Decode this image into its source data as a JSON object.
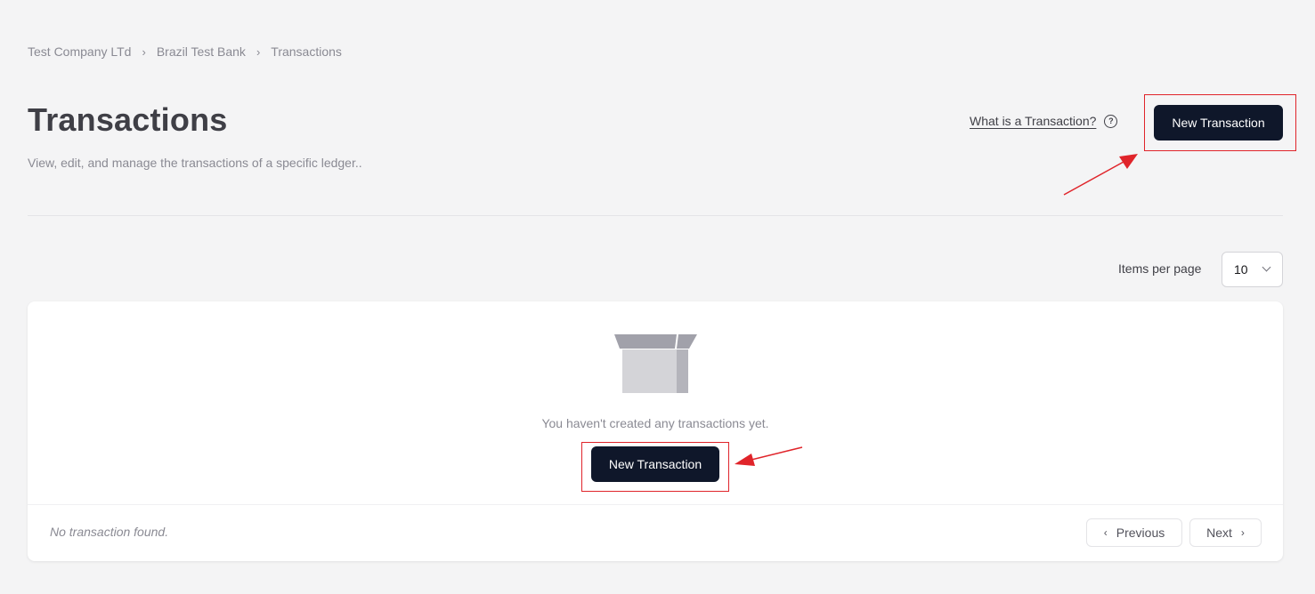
{
  "breadcrumb": {
    "items": [
      "Test Company LTd",
      "Brazil Test Bank",
      "Transactions"
    ],
    "separator": "›"
  },
  "header": {
    "title": "Transactions",
    "subtitle": "View, edit, and manage the transactions of a specific ledger..",
    "help_link": "What is a Transaction?",
    "help_icon": "?",
    "new_button": "New Transaction"
  },
  "pagination_controls": {
    "items_per_page_label": "Items per page",
    "items_per_page_value": "10"
  },
  "empty_state": {
    "icon": "empty-box-icon",
    "message": "You haven't created any transactions yet.",
    "new_button": "New Transaction"
  },
  "footer": {
    "note": "No transaction found.",
    "previous": "Previous",
    "next": "Next",
    "prev_arrow": "‹",
    "next_arrow": "›"
  },
  "colors": {
    "background": "#f4f4f5",
    "primary_button": "#0f172a",
    "annotation": "#e0242a"
  }
}
